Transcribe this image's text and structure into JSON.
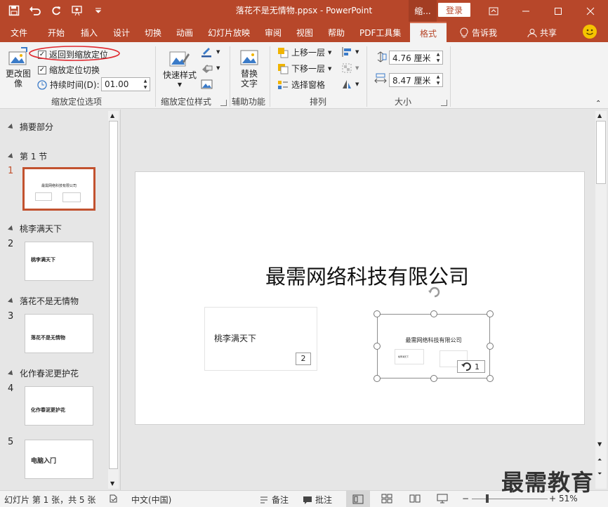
{
  "window": {
    "title": "落花不是无情物.ppsx  -  PowerPoint",
    "context_tab": "缩...",
    "login": "登录"
  },
  "tabs": [
    {
      "label": "文件"
    },
    {
      "label": "开始"
    },
    {
      "label": "插入"
    },
    {
      "label": "设计"
    },
    {
      "label": "切换"
    },
    {
      "label": "动画"
    },
    {
      "label": "幻灯片放映"
    },
    {
      "label": "审阅"
    },
    {
      "label": "视图"
    },
    {
      "label": "帮助"
    },
    {
      "label": "PDF工具集"
    },
    {
      "label": "格式"
    },
    {
      "label": "告诉我"
    },
    {
      "label": "共享"
    }
  ],
  "ribbon": {
    "change_image": {
      "line1": "更改图",
      "line2": "像"
    },
    "return_to_zoom": "返回到缩放定位",
    "zoom_transition": "缩放定位切换",
    "duration_label": "持续时间(D):",
    "duration_value": "01.00",
    "group_zoom_options": "缩放定位选项",
    "quick_styles": "快速样式",
    "group_zoom_styles": "缩放定位样式",
    "alt_text": {
      "line1": "替换",
      "line2": "文字"
    },
    "group_accessibility": "辅助功能",
    "bring_forward": "上移一层",
    "send_backward": "下移一层",
    "selection_pane": "选择窗格",
    "group_arrange": "排列",
    "height_value": "4.76 厘米",
    "width_value": "8.47 厘米",
    "group_size": "大小"
  },
  "sections": [
    {
      "label": "摘要部分"
    },
    {
      "label": "第 1 节"
    },
    {
      "label": "桃李满天下"
    },
    {
      "label": "落花不是无情物"
    },
    {
      "label": "化作春泥更护花"
    }
  ],
  "thumbnails": [
    {
      "num": "1",
      "text": "最需网络科技有限公司"
    },
    {
      "num": "2",
      "text": "桃李满天下"
    },
    {
      "num": "3",
      "text": "落花不是无情物"
    },
    {
      "num": "4",
      "text": "化作春泥更护花"
    },
    {
      "num": "5",
      "text": "电脑入门"
    }
  ],
  "slide": {
    "title": "最需网络科技有限公司",
    "zoom_card_label": "桃李满天下",
    "zoom_card_num": "2",
    "summary_zoom_title": "最需网络科技有限公司",
    "summary_zoom_mini1": "桃李满天下",
    "summary_zoom_num": "1"
  },
  "statusbar": {
    "slide_info": "幻灯片 第 1 张，共 5 张",
    "language": "中文(中国)",
    "notes": "备注",
    "comments": "批注",
    "zoom": "51%"
  },
  "watermark": "最需教育",
  "colors": {
    "accent": "#b7472a",
    "selection": "#c2522f"
  }
}
